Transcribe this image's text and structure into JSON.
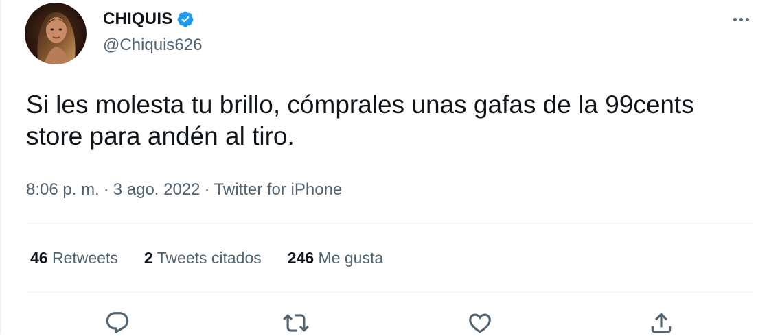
{
  "author": {
    "display_name": "CHIQUIS",
    "handle": "@Chiquis626",
    "verified": true
  },
  "tweet": {
    "text": "Si les molesta tu brillo, cómprales unas gafas de la 99cents store para andén al tiro."
  },
  "meta": {
    "time": "8:06 p. m.",
    "separator": "·",
    "date": "3 ago. 2022",
    "source": "Twitter for iPhone"
  },
  "stats": {
    "retweets_count": "46",
    "retweets_label": "Retweets",
    "quotes_count": "2",
    "quotes_label": "Tweets citados",
    "likes_count": "246",
    "likes_label": "Me gusta"
  },
  "actions": [
    "reply-icon",
    "retweet-icon",
    "like-icon",
    "share-icon"
  ],
  "colors": {
    "text_primary": "#0f1419",
    "text_secondary": "#536471",
    "verified_blue": "#1d9bf0",
    "divider": "#eff3f4"
  }
}
